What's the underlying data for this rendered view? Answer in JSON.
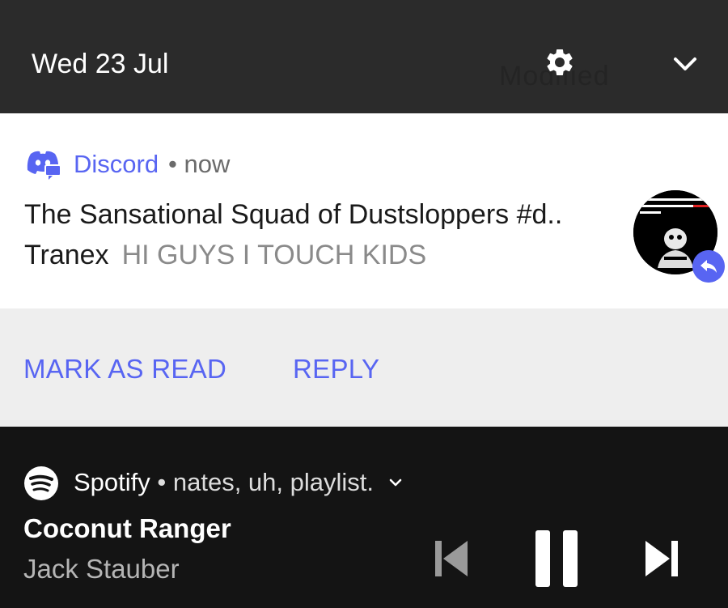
{
  "header": {
    "date": "Wed 23 Jul",
    "watermark": "Modified",
    "icons": {
      "settings": "gear-icon",
      "expand": "chevron-down-icon"
    }
  },
  "discord_notification": {
    "app_name": "Discord",
    "time": "• now",
    "title": "The Sansational Squad of Dustsloppers #d..",
    "sender": "Tranex",
    "message": "HI GUYS I TOUCH KIDS",
    "accent_color": "#5865f2",
    "icons": {
      "app": "discord-icon",
      "avatar": "avatar",
      "badge": "reply-icon"
    }
  },
  "actions": {
    "mark_as_read": "MARK AS READ",
    "reply": "REPLY"
  },
  "spotify_notification": {
    "app_name": "Spotify",
    "subtitle": "• nates, uh, playlist.",
    "track": "Coconut Ranger",
    "artist": "Jack Stauber",
    "icons": {
      "app": "spotify-icon",
      "expand": "chevron-down-icon",
      "previous": "skip-previous-icon",
      "pause": "pause-icon",
      "next": "skip-next-icon"
    }
  }
}
